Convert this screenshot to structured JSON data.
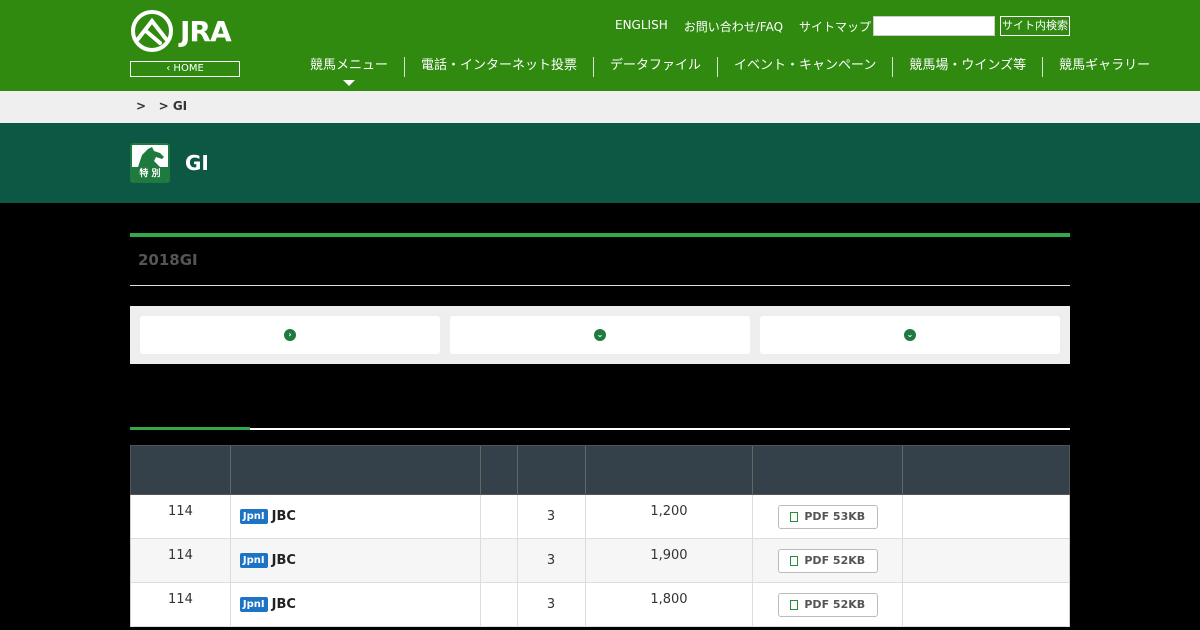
{
  "header": {
    "logo_text": "JRA",
    "home_label": "HOME",
    "top_links": [
      "ENGLISH",
      "お問い合わせ/FAQ",
      "サイトマップ"
    ],
    "search_placeholder": "",
    "search_button": "サイト内検索",
    "nav": [
      "競馬メニュー",
      "電話・インターネット投票",
      "データファイル",
      "イベント・キャンペーン",
      "競馬場・ウインズ等",
      "競馬ギャラリー"
    ]
  },
  "breadcrumb": ">   > GI",
  "page": {
    "icon_label": "特 別",
    "title": "GI"
  },
  "section": {
    "title": "2018GI"
  },
  "table": {
    "rows": [
      {
        "c1": "114",
        "badge": "JpnI",
        "race": "JBC",
        "c4": "3",
        "c5": "1,200",
        "pdf": "PDF 53KB"
      },
      {
        "c1": "114",
        "badge": "JpnI",
        "race": "JBC",
        "c4": "3",
        "c5": "1,900",
        "pdf": "PDF 52KB"
      },
      {
        "c1": "114",
        "badge": "JpnI",
        "race": "JBC",
        "c4": "3",
        "c5": "1,800",
        "pdf": "PDF 52KB"
      }
    ]
  },
  "colors": {
    "header_green": "#2f8a0f",
    "title_band": "#0d5745",
    "accent": "#33a84a",
    "table_head": "#34404a",
    "badge_blue": "#1d74c4"
  }
}
